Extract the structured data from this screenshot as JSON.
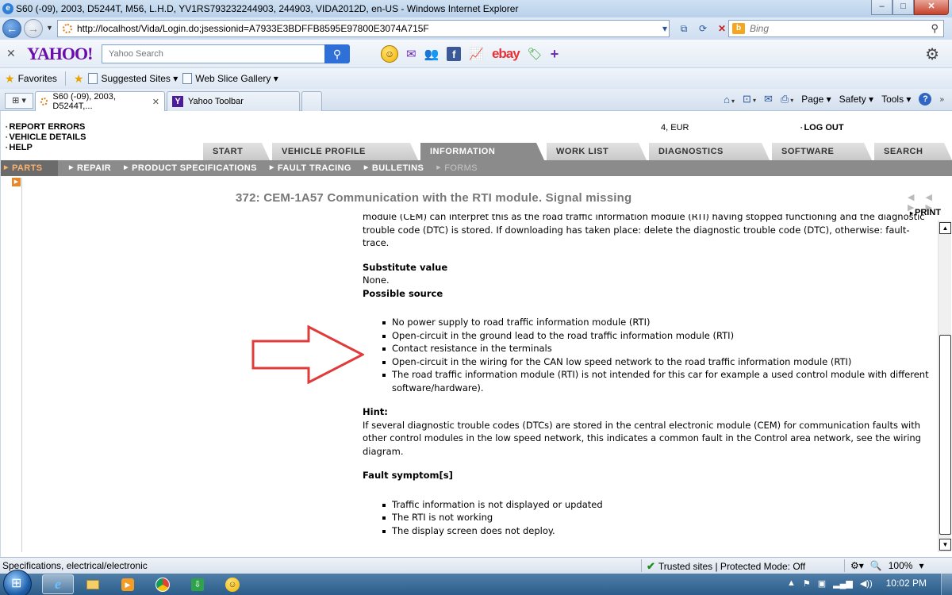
{
  "window": {
    "title": "S60 (-09), 2003, D5244T, M56, L.H.D, YV1RS793232244903, 244903, VIDA2012D, en-US - Windows Internet Explorer",
    "min": "–",
    "max": "□",
    "close": "✕"
  },
  "address_bar": {
    "url": "http://localhost/Vida/Login.do;jsessionid=A7933E3BDFFB8595E97800E3074A715F",
    "search_placeholder": "Bing"
  },
  "yahoo_toolbar": {
    "logo": "YAHOO!",
    "search_placeholder": "Yahoo Search",
    "ebay_label": "ebay"
  },
  "favorites_bar": {
    "favorites": "Favorites",
    "suggested_sites": "Suggested Sites ▾",
    "web_slice_gallery": "Web Slice Gallery ▾"
  },
  "tabs": [
    {
      "label": "S60 (-09), 2003, D5244T,..."
    },
    {
      "label": "Yahoo Toolbar"
    }
  ],
  "command_bar": {
    "page": "Page ▾",
    "safety": "Safety ▾",
    "tools": "Tools ▾"
  },
  "vida": {
    "top_links": [
      "REPORT ERRORS",
      "VEHICLE DETAILS",
      "HELP"
    ],
    "account": "4, EUR",
    "logout": "LOG OUT",
    "main_tabs": [
      "START",
      "VEHICLE PROFILE",
      "INFORMATION",
      "WORK LIST",
      "DIAGNOSTICS",
      "SOFTWARE",
      "SEARCH"
    ],
    "active_main_tab": "INFORMATION",
    "sub_nav": [
      "PARTS",
      "REPAIR",
      "PRODUCT SPECIFICATIONS",
      "FAULT TRACING",
      "BULLETINS",
      "FORMS"
    ],
    "active_sub_nav": "PARTS",
    "pager": "◀◀ ▶▶",
    "print": "PRINT"
  },
  "document": {
    "title": "372: CEM-1A57 Communication with the RTI module. Signal missing",
    "intro_partial": "module (CEM) can interpret this as the road traffic information module (RTI) having stopped functioning and the diagnostic trouble code (DTC) is stored. If downloading has taken place: delete the diagnostic trouble code (DTC), otherwise: fault-trace.",
    "substitute_heading": "Substitute value",
    "substitute_value": "None.",
    "possible_source_heading": "Possible source",
    "possible_sources": [
      "No power supply to road traffic information module (RTI)",
      "Open-circuit in the ground lead to the road traffic information module (RTI)",
      "Contact resistance in the terminals",
      "Open-circuit in the wiring for the CAN low speed network to the road traffic information module (RTI)",
      "The road traffic information module (RTI) is not intended for this car for example a used control module with different software/hardware)."
    ],
    "hint_heading": "Hint:",
    "hint_text": "If several diagnostic trouble codes (DTCs) are stored in the central electronic module (CEM) for communication faults with other control modules in the low speed network, this indicates a common fault in the Control area network, see the wiring diagram.",
    "fault_symptom_heading": "Fault symptom[s]",
    "fault_symptoms": [
      "Traffic information is not displayed or updated",
      "The RTI is not working",
      "The display screen does not deploy."
    ]
  },
  "status_bar": {
    "text": "Specifications, electrical/electronic",
    "zone": "Trusted sites | Protected Mode: Off",
    "zoom": "100%"
  },
  "taskbar": {
    "time": "10:02 PM"
  },
  "colors": {
    "arrow": "#e03a3a",
    "tab_active": "#8b8b8b",
    "subnav_active_text": "#ffb26b"
  }
}
